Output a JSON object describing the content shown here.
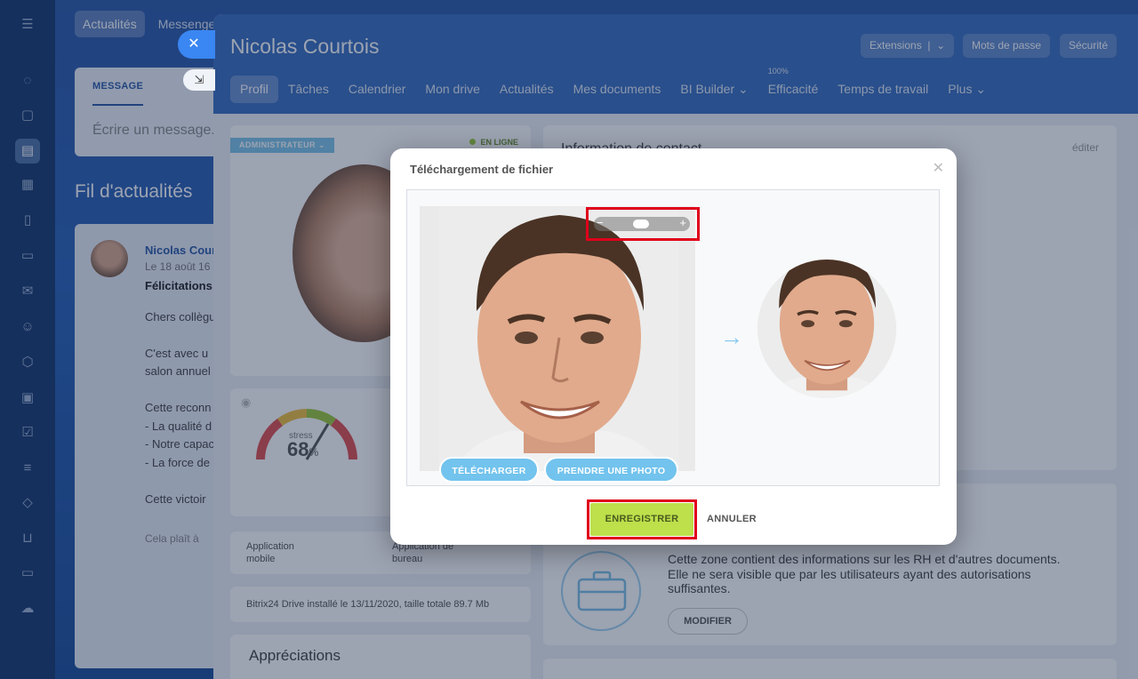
{
  "feed_tabs": [
    "Actualités",
    "Messenger"
  ],
  "message_box": {
    "tab": "MESSAGE",
    "placeholder": "Écrire un message..."
  },
  "feed": {
    "title": "Fil d'actualités",
    "author": "Nicolas Courtois",
    "date": "Le 18 août 16",
    "headline": "Félicitations",
    "lines": [
      "Chers collègues,",
      "",
      "C'est avec u",
      "salon annuel",
      "",
      "Cette reconn",
      "- La qualité d",
      "- Notre capac",
      "- La force de",
      "",
      "Cette victoir",
      "",
      "Cela plaît à"
    ]
  },
  "profile": {
    "name": "Nicolas Courtois",
    "buttons": [
      "Extensions",
      "Mots de passe",
      "Sécurité"
    ],
    "tabs": [
      "Profil",
      "Tâches",
      "Calendrier",
      "Mon drive",
      "Actualités",
      "Mes documents",
      "BI Builder",
      "Efficacité",
      "Temps de travail",
      "Plus"
    ],
    "efficiency_pct": "100%",
    "role_badge": "ADMINISTRATEUR",
    "status": "EN LIGNE",
    "stress_label": "stress",
    "stress_value": "68",
    "stress_unit": "%",
    "app_mobile": "Application mobile",
    "app_desktop": "Application de bureau",
    "drive_info": "Bitrix24 Drive installé le 13/11/2020, taille totale 89.7 Mb",
    "appreciations": "Appréciations",
    "contact_title": "Information de contact",
    "edit_link": "éditer",
    "hr_text": [
      "Cette zone contient des informations sur les RH et d'autres documents.",
      "Elle ne sera visible que par les utilisateurs ayant des autorisations",
      "suffisantes."
    ],
    "hr_button": "MODIFIER"
  },
  "modal": {
    "title": "Téléchargement de fichier",
    "upload_label": "TÉLÉCHARGER",
    "photo_label": "PRENDRE UNE PHOTO",
    "save_label": "ENREGISTRER",
    "cancel_label": "ANNULER"
  },
  "colors": {
    "accent": "#3a86f2",
    "save": "#bde04b",
    "pill": "#72c3ed",
    "highlight": "#e0001b"
  }
}
